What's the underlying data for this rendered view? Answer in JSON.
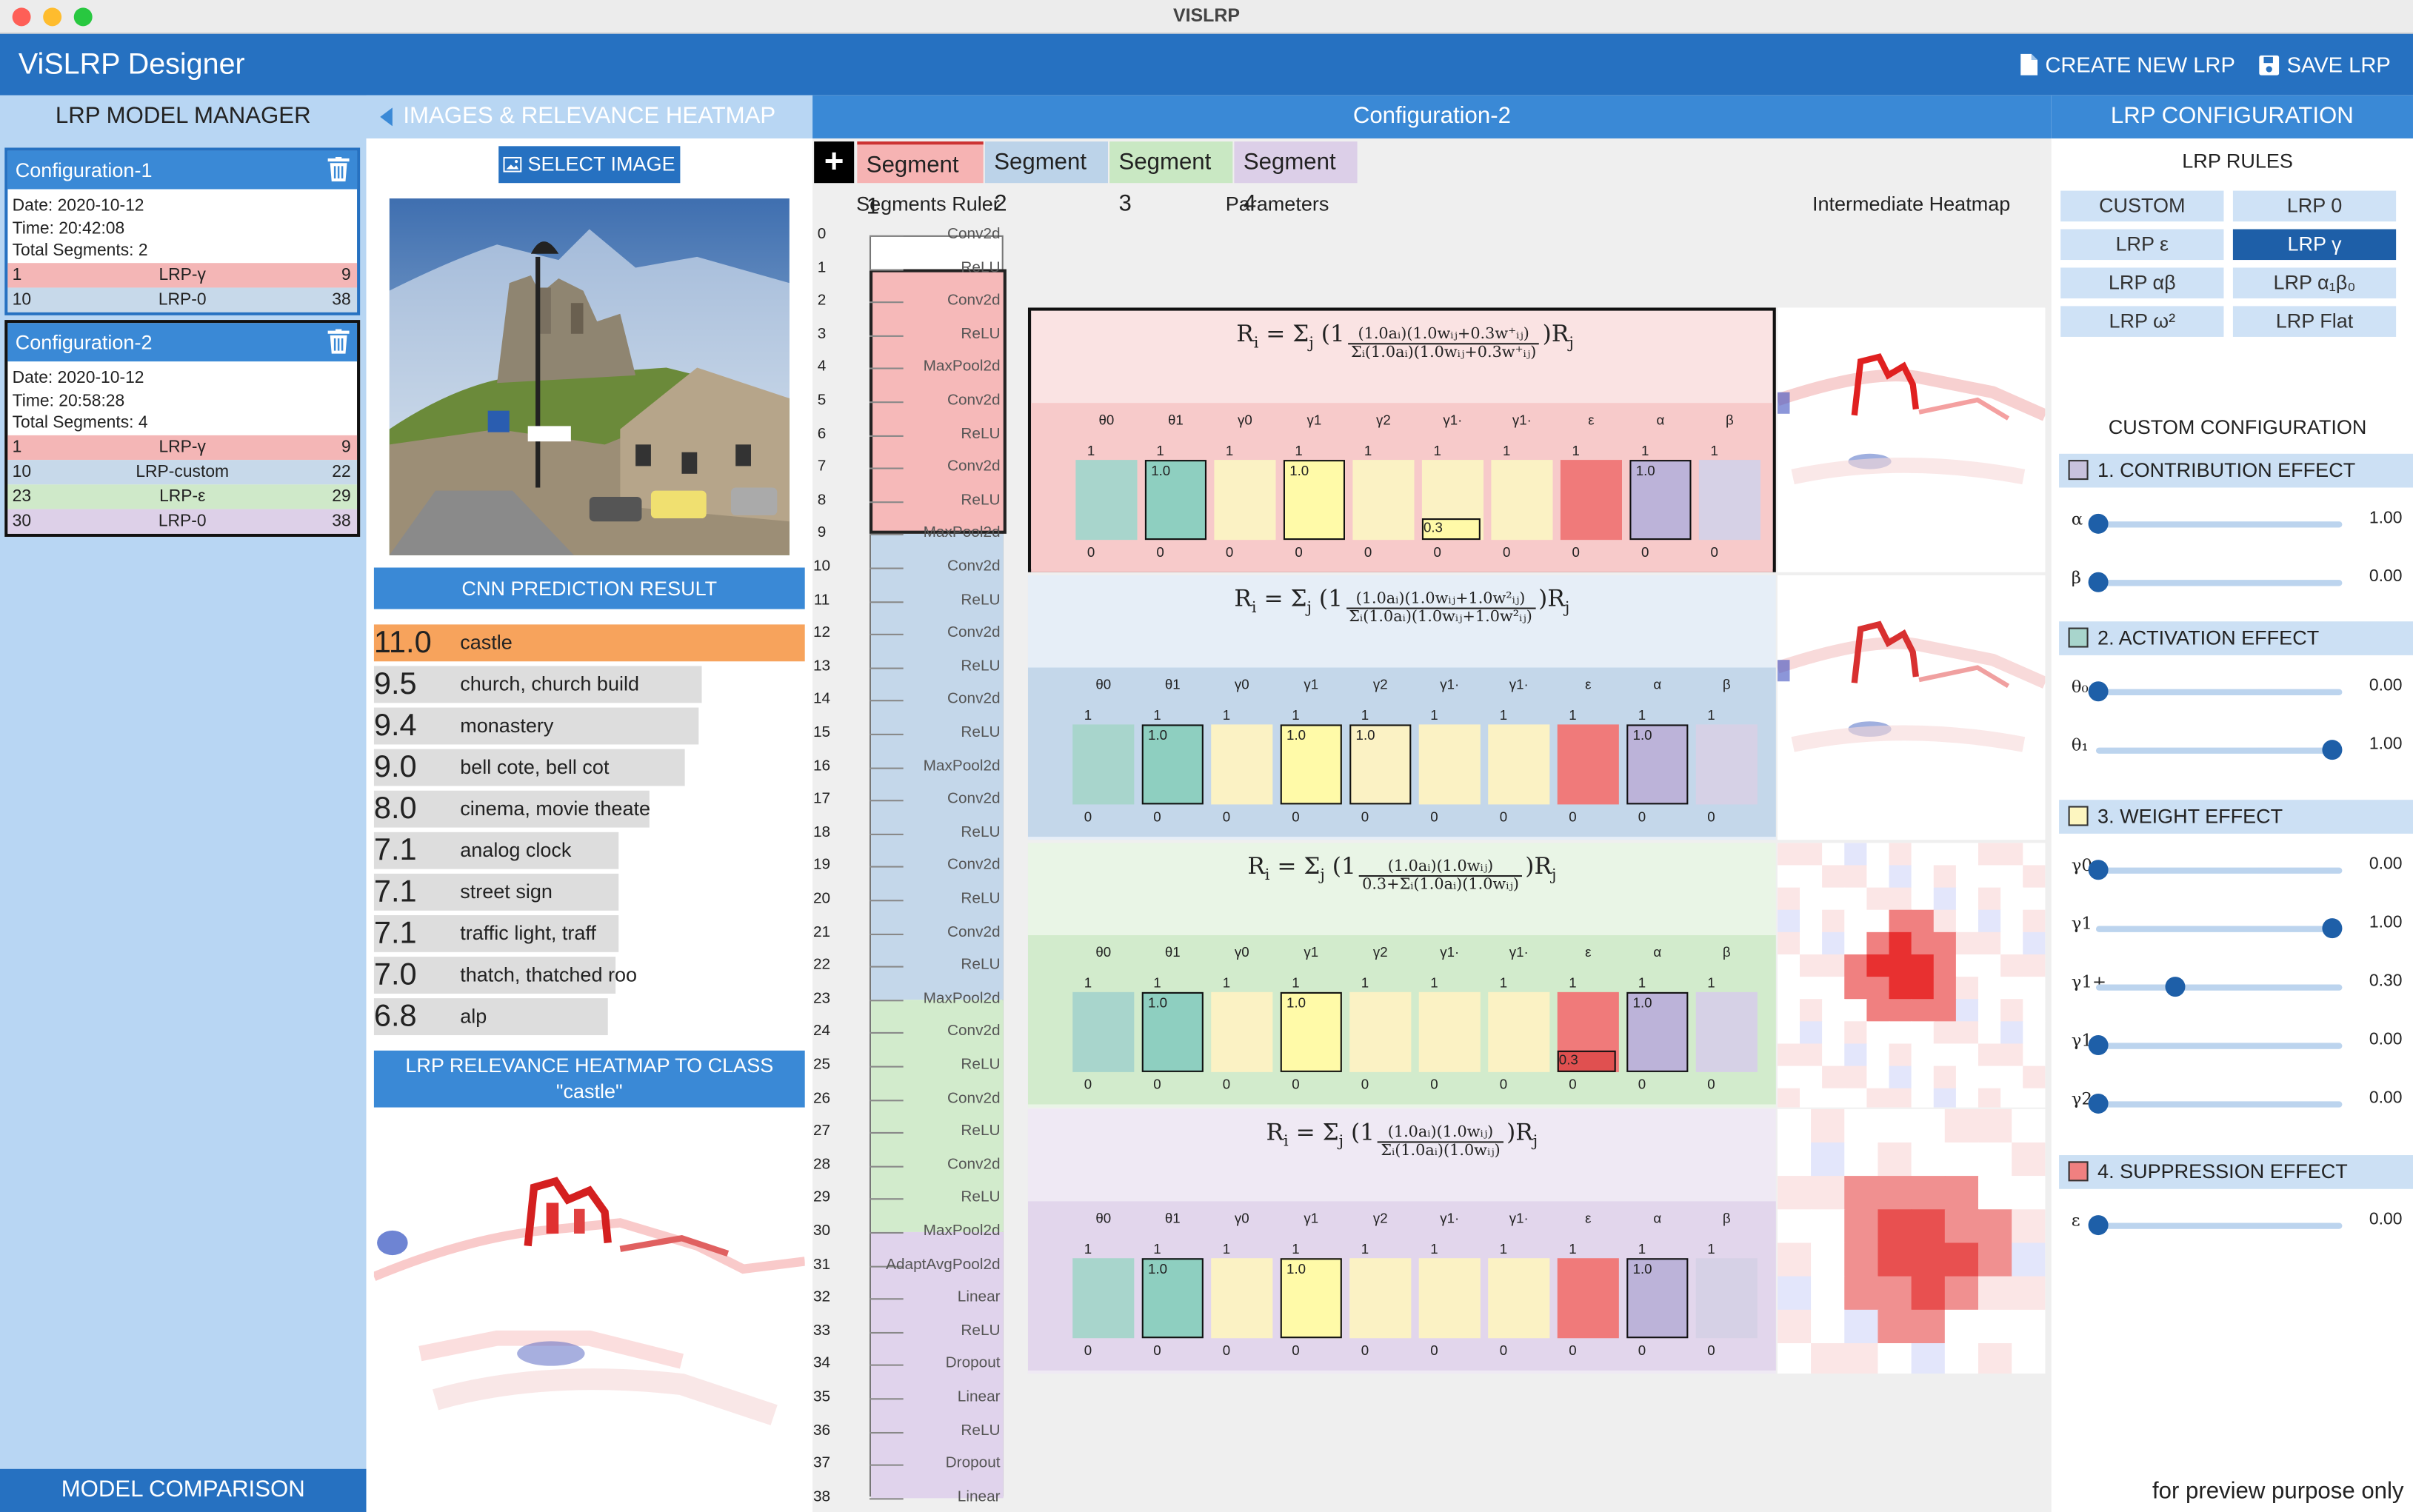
{
  "window": {
    "title": "VISLRP"
  },
  "app": {
    "title": "ViSLRP Designer",
    "create_label": "CREATE NEW LRP",
    "save_label": "SAVE LRP"
  },
  "headers": {
    "manager": "LRP MODEL MANAGER",
    "images": "IMAGES & RELEVANCE HEATMAP",
    "config": "Configuration-2",
    "lrp_config": "LRP CONFIGURATION"
  },
  "manager": {
    "configs": [
      {
        "name": "Configuration-1",
        "date": "Date: 2020-10-12",
        "time": "Time: 20:42:08",
        "total": "Total Segments: 2",
        "segments": [
          {
            "start": "1",
            "rule": "LRP-γ",
            "end": "9",
            "color": "#f4b6b6"
          },
          {
            "start": "10",
            "rule": "LRP-0",
            "end": "38",
            "color": "#c7d9ea"
          }
        ]
      },
      {
        "name": "Configuration-2",
        "date": "Date: 2020-10-12",
        "time": "Time: 20:58:28",
        "total": "Total Segments: 4",
        "segments": [
          {
            "start": "1",
            "rule": "LRP-γ",
            "end": "9",
            "color": "#f4b6b6"
          },
          {
            "start": "10",
            "rule": "LRP-custom",
            "end": "22",
            "color": "#c7d9ea"
          },
          {
            "start": "23",
            "rule": "LRP-ε",
            "end": "29",
            "color": "#cfe9c9"
          },
          {
            "start": "30",
            "rule": "LRP-0",
            "end": "38",
            "color": "#ddd0e8"
          }
        ]
      }
    ],
    "comparison": "MODEL COMPARISON"
  },
  "images": {
    "select_label": "SELECT IMAGE",
    "prediction_header": "CNN PREDICTION RESULT",
    "predictions": [
      {
        "score": "11.0",
        "label": "castle",
        "value": 11.0
      },
      {
        "score": "9.5",
        "label": "church, church build",
        "value": 9.5
      },
      {
        "score": "9.4",
        "label": "monastery",
        "value": 9.4
      },
      {
        "score": "9.0",
        "label": "bell cote, bell cot",
        "value": 9.0
      },
      {
        "score": "8.0",
        "label": "cinema, movie theate",
        "value": 8.0
      },
      {
        "score": "7.1",
        "label": "analog clock",
        "value": 7.1
      },
      {
        "score": "7.1",
        "label": "street sign",
        "value": 7.1
      },
      {
        "score": "7.1",
        "label": "traffic light, traff",
        "value": 7.1
      },
      {
        "score": "7.0",
        "label": "thatch, thatched roo",
        "value": 7.0
      },
      {
        "score": "6.8",
        "label": "alp",
        "value": 6.8
      }
    ],
    "heatmap_header_1": "LRP RELEVANCE HEATMAP TO CLASS",
    "heatmap_header_2": "\"castle\""
  },
  "config": {
    "tabs": [
      {
        "label": "Segment 1",
        "color": "#f6b3b3",
        "active": true
      },
      {
        "label": "Segment 2",
        "color": "#bcd3e9"
      },
      {
        "label": "Segment 3",
        "color": "#c9e8c3"
      },
      {
        "label": "Segment 4",
        "color": "#dccfe8"
      }
    ],
    "add_label": "+",
    "col_ruler": "Segments Ruler",
    "col_params": "Parameters",
    "col_heatmap": "Intermediate Heatmap",
    "layers": [
      "Conv2d",
      "ReLU",
      "Conv2d",
      "ReLU",
      "MaxPool2d",
      "Conv2d",
      "ReLU",
      "Conv2d",
      "ReLU",
      "MaxPool2d",
      "Conv2d",
      "ReLU",
      "Conv2d",
      "ReLU",
      "Conv2d",
      "ReLU",
      "MaxPool2d",
      "Conv2d",
      "ReLU",
      "Conv2d",
      "ReLU",
      "Conv2d",
      "ReLU",
      "MaxPool2d",
      "Conv2d",
      "ReLU",
      "Conv2d",
      "ReLU",
      "Conv2d",
      "ReLU",
      "MaxPool2d",
      "AdaptAvgPool2d",
      "Linear",
      "ReLU",
      "Dropout",
      "Linear",
      "ReLU",
      "Dropout",
      "Linear"
    ],
    "ruler_numbers": [
      "0",
      "1",
      "2",
      "3",
      "4",
      "5",
      "6",
      "7",
      "8",
      "9",
      "10",
      "11",
      "12",
      "13",
      "14",
      "15",
      "16",
      "17",
      "18",
      "19",
      "20",
      "21",
      "22",
      "23",
      "24",
      "25",
      "26",
      "27",
      "28",
      "29",
      "30",
      "31",
      "32",
      "33",
      "34",
      "35",
      "36",
      "37",
      "38"
    ],
    "param_labels": [
      "θ0",
      "θ1",
      "γ0",
      "γ1",
      "γ2",
      "γ1·",
      "γ1·",
      "ε",
      "α",
      "β"
    ],
    "segments": [
      {
        "formula_lhs": "R",
        "formula": "Rᵢ = Σⱼ (1 (1.0aᵢ)(1.0wᵢⱼ+0.3w⁺ᵢⱼ) / Σᵢ(1.0aᵢ)(1.0wᵢⱼ+0.3w⁺ᵢⱼ) )Rⱼ",
        "num": "(1.0aᵢ)(1.0wᵢⱼ+0.3w⁺ᵢⱼ)",
        "den": "Σᵢ(1.0aᵢ)(1.0wᵢⱼ+0.3w⁺ᵢⱼ)",
        "bg_top": "#fae3e3",
        "bg": "#f7caca",
        "selected": true,
        "inner": [
          "",
          "1.0",
          "",
          "1.0",
          "",
          "0.3",
          "",
          "",
          "1.0",
          ""
        ],
        "bordered": [
          false,
          true,
          false,
          true,
          false,
          false,
          false,
          false,
          true,
          false
        ]
      },
      {
        "num": "(1.0aᵢ)(1.0wᵢⱼ+1.0w²ᵢⱼ)",
        "den": "Σᵢ(1.0aᵢ)(1.0wᵢⱼ+1.0w²ᵢⱼ)",
        "bg_top": "#e6eef7",
        "bg": "#c4d7ea",
        "inner": [
          "",
          "1.0",
          "",
          "1.0",
          "1.0",
          "",
          "",
          "",
          "1.0",
          ""
        ],
        "bordered": [
          false,
          true,
          false,
          true,
          true,
          false,
          false,
          false,
          true,
          false
        ]
      },
      {
        "num": "(1.0aᵢ)(1.0wᵢⱼ)",
        "den": "0.3+Σᵢ(1.0aᵢ)(1.0wᵢⱼ)",
        "bg_top": "#e9f5e6",
        "bg": "#d2ebcc",
        "inner": [
          "",
          "1.0",
          "",
          "1.0",
          "",
          "",
          "",
          "0.3",
          "1.0",
          ""
        ],
        "bordered": [
          false,
          true,
          false,
          true,
          false,
          false,
          false,
          false,
          true,
          false
        ]
      },
      {
        "num": "(1.0aᵢ)(1.0wᵢⱼ)",
        "den": "Σᵢ(1.0aᵢ)(1.0wᵢⱼ)",
        "bg_top": "#efe9f4",
        "bg": "#e2d6ec",
        "inner": [
          "",
          "1.0",
          "",
          "1.0",
          "",
          "",
          "",
          "",
          "1.0",
          ""
        ],
        "bordered": [
          false,
          true,
          false,
          true,
          false,
          false,
          false,
          false,
          true,
          false
        ]
      }
    ],
    "one": "1",
    "zero": "0"
  },
  "lrp": {
    "rules_title": "LRP RULES",
    "rules": [
      {
        "label": "CUSTOM"
      },
      {
        "label": "LRP 0"
      },
      {
        "label": "LRP ε"
      },
      {
        "label": "LRP γ",
        "selected": true
      },
      {
        "label": "LRP αβ"
      },
      {
        "label": "LRP α₁β₀"
      },
      {
        "label": "LRP ω²"
      },
      {
        "label": "LRP Flat"
      }
    ],
    "custom_title": "CUSTOM CONFIGURATION",
    "effects": [
      {
        "title": "1. CONTRIBUTION EFFECT",
        "color": "#c8c2dd",
        "sliders": [
          {
            "symbol": "α",
            "value": "1.00",
            "level": 0.0
          },
          {
            "symbol": "β",
            "value": "0.00",
            "level": 0.0
          }
        ]
      },
      {
        "title": "2. ACTIVATION EFFECT",
        "color": "#a8d5cc",
        "sliders": [
          {
            "symbol": "θ₀",
            "value": "0.00",
            "level": 0.0
          },
          {
            "symbol": "θ₁",
            "value": "1.00",
            "level": 1.0
          }
        ]
      },
      {
        "title": "3. WEIGHT EFFECT",
        "color": "#fdf6c0",
        "sliders": [
          {
            "symbol": "γ0",
            "value": "0.00",
            "level": 0.0
          },
          {
            "symbol": "γ1",
            "value": "1.00",
            "level": 1.0
          },
          {
            "symbol": "γ1+",
            "value": "0.30",
            "level": 0.33
          },
          {
            "symbol": "γ1-",
            "value": "0.00",
            "level": 0.0
          },
          {
            "symbol": "γ2",
            "value": "0.00",
            "level": 0.0
          }
        ]
      },
      {
        "title": "4. SUPPRESSION EFFECT",
        "color": "#f08080",
        "sliders": [
          {
            "symbol": "ε",
            "value": "0.00",
            "level": 0.0
          }
        ]
      }
    ],
    "footer": "for preview purpose only"
  }
}
